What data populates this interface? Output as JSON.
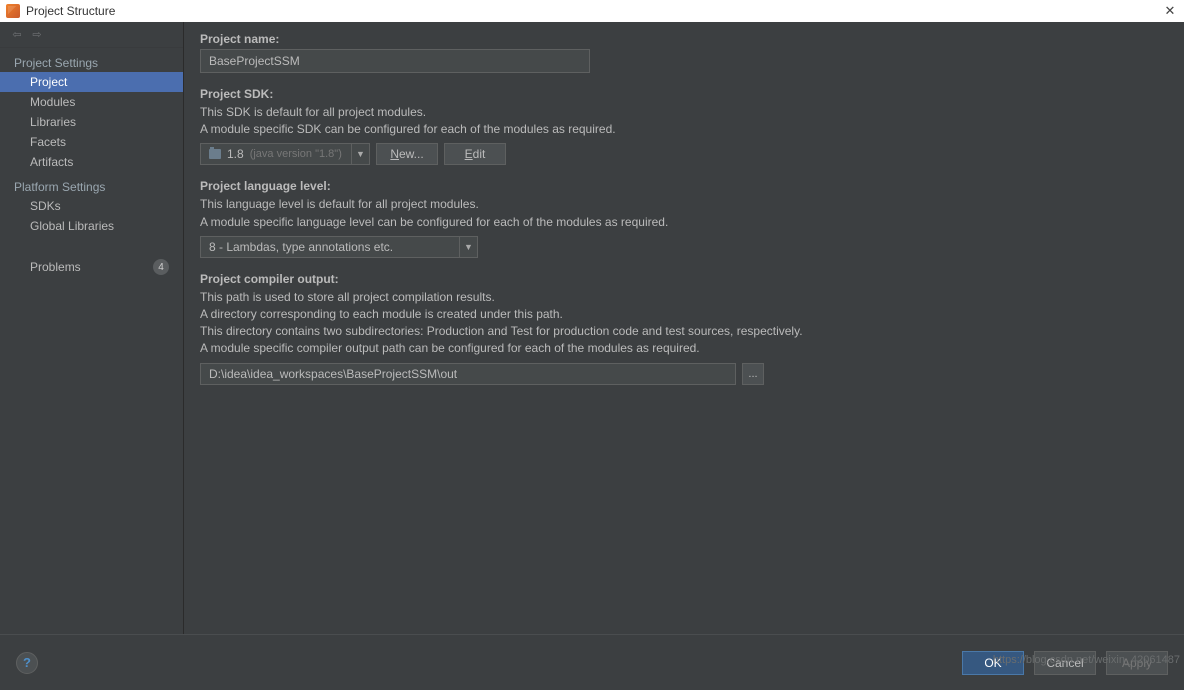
{
  "titlebar": {
    "title": "Project Structure",
    "close": "✕"
  },
  "sidebar": {
    "nav_back": "←",
    "nav_fwd": "→",
    "section1": "Project Settings",
    "items1": [
      {
        "label": "Project"
      },
      {
        "label": "Modules"
      },
      {
        "label": "Libraries"
      },
      {
        "label": "Facets"
      },
      {
        "label": "Artifacts"
      }
    ],
    "section2": "Platform Settings",
    "items2": [
      {
        "label": "SDKs"
      },
      {
        "label": "Global Libraries"
      }
    ],
    "problems": {
      "label": "Problems",
      "count": "4"
    }
  },
  "projectName": {
    "label": "Project name:",
    "value": "BaseProjectSSM"
  },
  "projectSdk": {
    "label": "Project SDK:",
    "desc1": "This SDK is default for all project modules.",
    "desc2": "A module specific SDK can be configured for each of the modules as required.",
    "value": "1.8",
    "detail": "(java version \"1.8\")",
    "new": "ew...",
    "newPrefix": "N",
    "edit": "dit",
    "editPrefix": "E"
  },
  "langLevel": {
    "label": "Project language level:",
    "desc1": "This language level is default for all project modules.",
    "desc2": "A module specific language level can be configured for each of the modules as required.",
    "value": "8 - Lambdas, type annotations etc."
  },
  "compilerOutput": {
    "label": "Project compiler output:",
    "desc1": "This path is used to store all project compilation results.",
    "desc2": "A directory corresponding to each module is created under this path.",
    "desc3": "This directory contains two subdirectories: Production and Test for production code and test sources, respectively.",
    "desc4": "A module specific compiler output path can be configured for each of the modules as required.",
    "value": "D:\\idea\\idea_workspaces\\BaseProjectSSM\\out",
    "browse": "..."
  },
  "buttons": {
    "help": "?",
    "ok": "OK",
    "cancel": "Cancel",
    "apply": "Apply"
  },
  "watermark": "https://blog.csdn.net/weixin_42061487"
}
